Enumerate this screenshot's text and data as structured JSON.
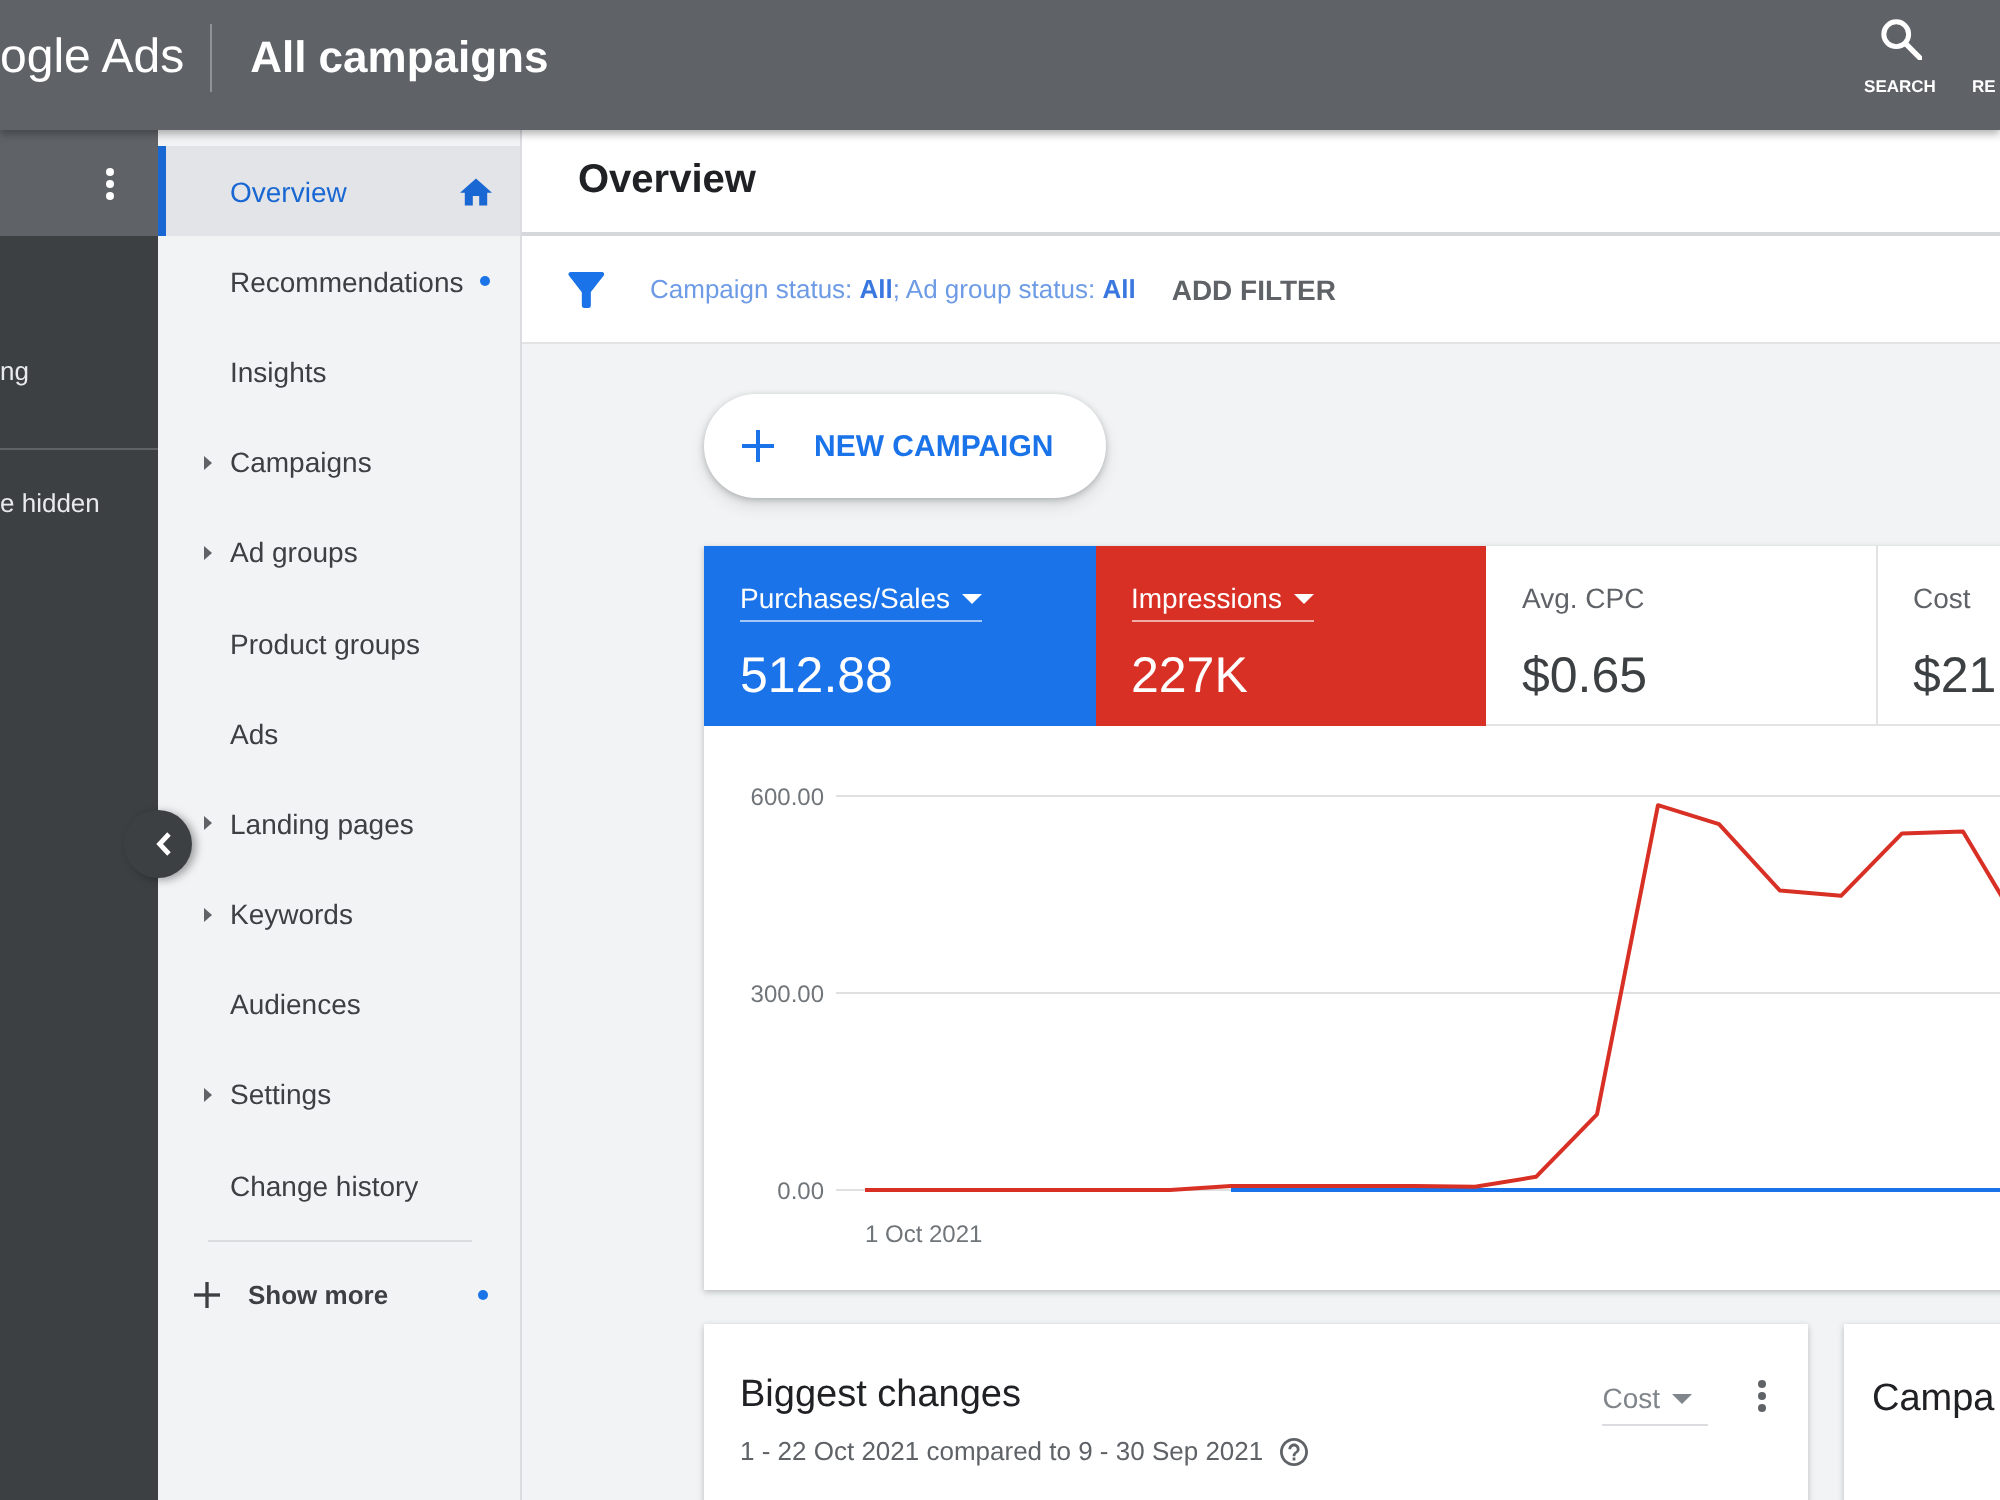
{
  "topbar": {
    "product": "ogle Ads",
    "title": "All campaigns",
    "actions": [
      {
        "kind": "search",
        "label": "SEARCH"
      },
      {
        "kind": "cut",
        "label": "RE"
      }
    ]
  },
  "account_panel": {
    "sections": [
      "ng",
      "e hidden"
    ]
  },
  "nav": {
    "items": [
      {
        "label": "Overview",
        "kind": "home",
        "selected": true,
        "dot": false
      },
      {
        "label": "Recommendations",
        "kind": "plain",
        "selected": false,
        "dot": true
      },
      {
        "label": "Insights",
        "kind": "plain",
        "selected": false,
        "dot": false
      },
      {
        "label": "Campaigns",
        "kind": "expandable",
        "selected": false,
        "dot": false
      },
      {
        "label": "Ad groups",
        "kind": "expandable",
        "selected": false,
        "dot": false
      },
      {
        "label": "Product groups",
        "kind": "plain",
        "selected": false,
        "dot": false
      },
      {
        "label": "Ads",
        "kind": "plain",
        "selected": false,
        "dot": false
      },
      {
        "label": "Landing pages",
        "kind": "expandable",
        "selected": false,
        "dot": false
      },
      {
        "label": "Keywords",
        "kind": "expandable",
        "selected": false,
        "dot": false
      },
      {
        "label": "Audiences",
        "kind": "plain",
        "selected": false,
        "dot": false
      },
      {
        "label": "Settings",
        "kind": "expandable",
        "selected": false,
        "dot": false
      },
      {
        "label": "Change history",
        "kind": "plain",
        "selected": false,
        "dot": false
      }
    ],
    "show_more": {
      "label": "Show more",
      "dot": true
    }
  },
  "page": {
    "heading": "Overview"
  },
  "filter_bar": {
    "summary": "Campaign status: **All**; Ad group status: **All**",
    "add_filter": "ADD FILTER"
  },
  "new_campaign": {
    "label": "NEW CAMPAIGN"
  },
  "performance": {
    "metrics": [
      {
        "label": "Purchases/Sales",
        "value": "512.88",
        "selected": true,
        "color": "#1a73e8"
      },
      {
        "label": "Impressions",
        "value": "227K",
        "selected": true,
        "color": "#d93025"
      },
      {
        "label": "Avg. CPC",
        "value": "$0.65",
        "selected": false
      },
      {
        "label": "Cost",
        "value": "$21",
        "selected": false
      }
    ],
    "chart_start_label": "1 Oct 2021",
    "chart_data": {
      "type": "line",
      "series": [
        {
          "color": "#1a73e8",
          "values": [
            null,
            null,
            null,
            null,
            null,
            null,
            0,
            0,
            0,
            0,
            0,
            0,
            0,
            0,
            0,
            0,
            0,
            0,
            0,
            0
          ]
        },
        {
          "color": "#d93025",
          "values": [
            0,
            0,
            0,
            0,
            0,
            0,
            6,
            6,
            6,
            6,
            5,
            20,
            115,
            586,
            557,
            456,
            448,
            543,
            546,
            390
          ]
        }
      ],
      "ylim": [
        0,
        600
      ],
      "yticks": [
        {
          "value": 0,
          "label": "0.00"
        },
        {
          "value": 300,
          "label": "300.00"
        },
        {
          "value": 600,
          "label": "600.00"
        }
      ]
    }
  },
  "cards": [
    {
      "kind": "changes",
      "title": "Biggest changes",
      "subtitle": "1 - 22 Oct 2021 compared to 9 - 30 Sep 2021",
      "metric": "Cost"
    },
    {
      "kind": "summary",
      "title": "Campa"
    }
  ]
}
